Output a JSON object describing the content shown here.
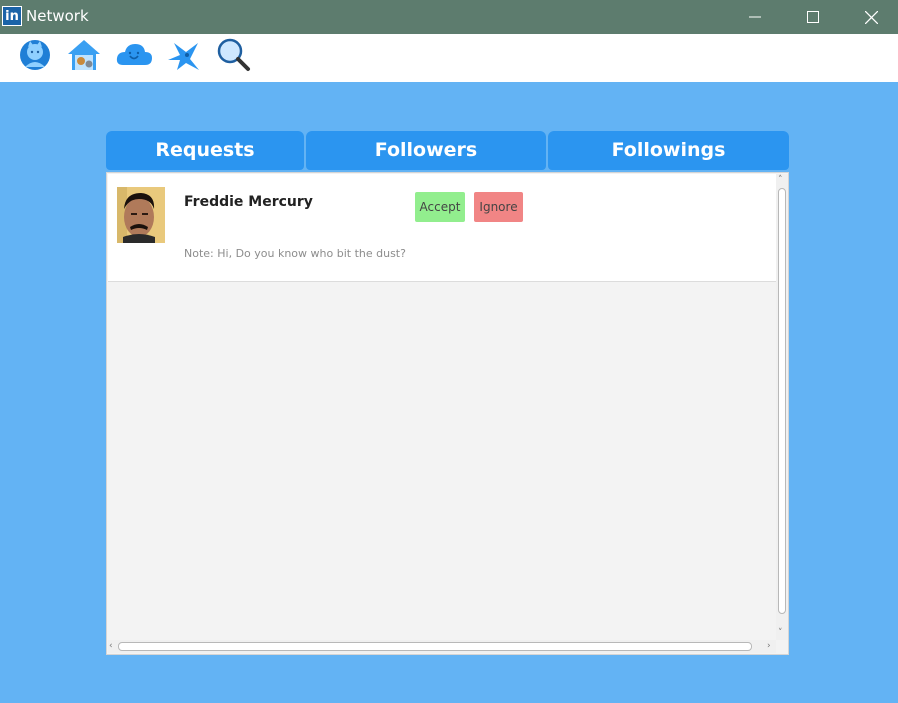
{
  "window": {
    "icon_text": "in",
    "title": "Network",
    "minimize_icon": "minimize-icon",
    "maximize_icon": "maximize-icon",
    "close_icon": "close-icon"
  },
  "toolbar": {
    "items": [
      {
        "name": "profile",
        "icon": "profile-avatar-icon"
      },
      {
        "name": "home",
        "icon": "home-icon"
      },
      {
        "name": "cloud",
        "icon": "cloud-icon"
      },
      {
        "name": "messages",
        "icon": "bird-icon"
      },
      {
        "name": "search",
        "icon": "search-icon"
      }
    ]
  },
  "tabs": [
    {
      "label": "Requests"
    },
    {
      "label": "Followers"
    },
    {
      "label": "Followings"
    }
  ],
  "requests": [
    {
      "name": "Freddie Mercury",
      "note": "Note: Hi, Do you know who bit the dust?",
      "accept_label": "Accept",
      "ignore_label": "Ignore"
    }
  ],
  "colors": {
    "titlebar": "#5d7c6e",
    "background": "#63b3f4",
    "tab": "#2b95f0",
    "accept": "#92ee8e",
    "ignore": "#f18585"
  }
}
